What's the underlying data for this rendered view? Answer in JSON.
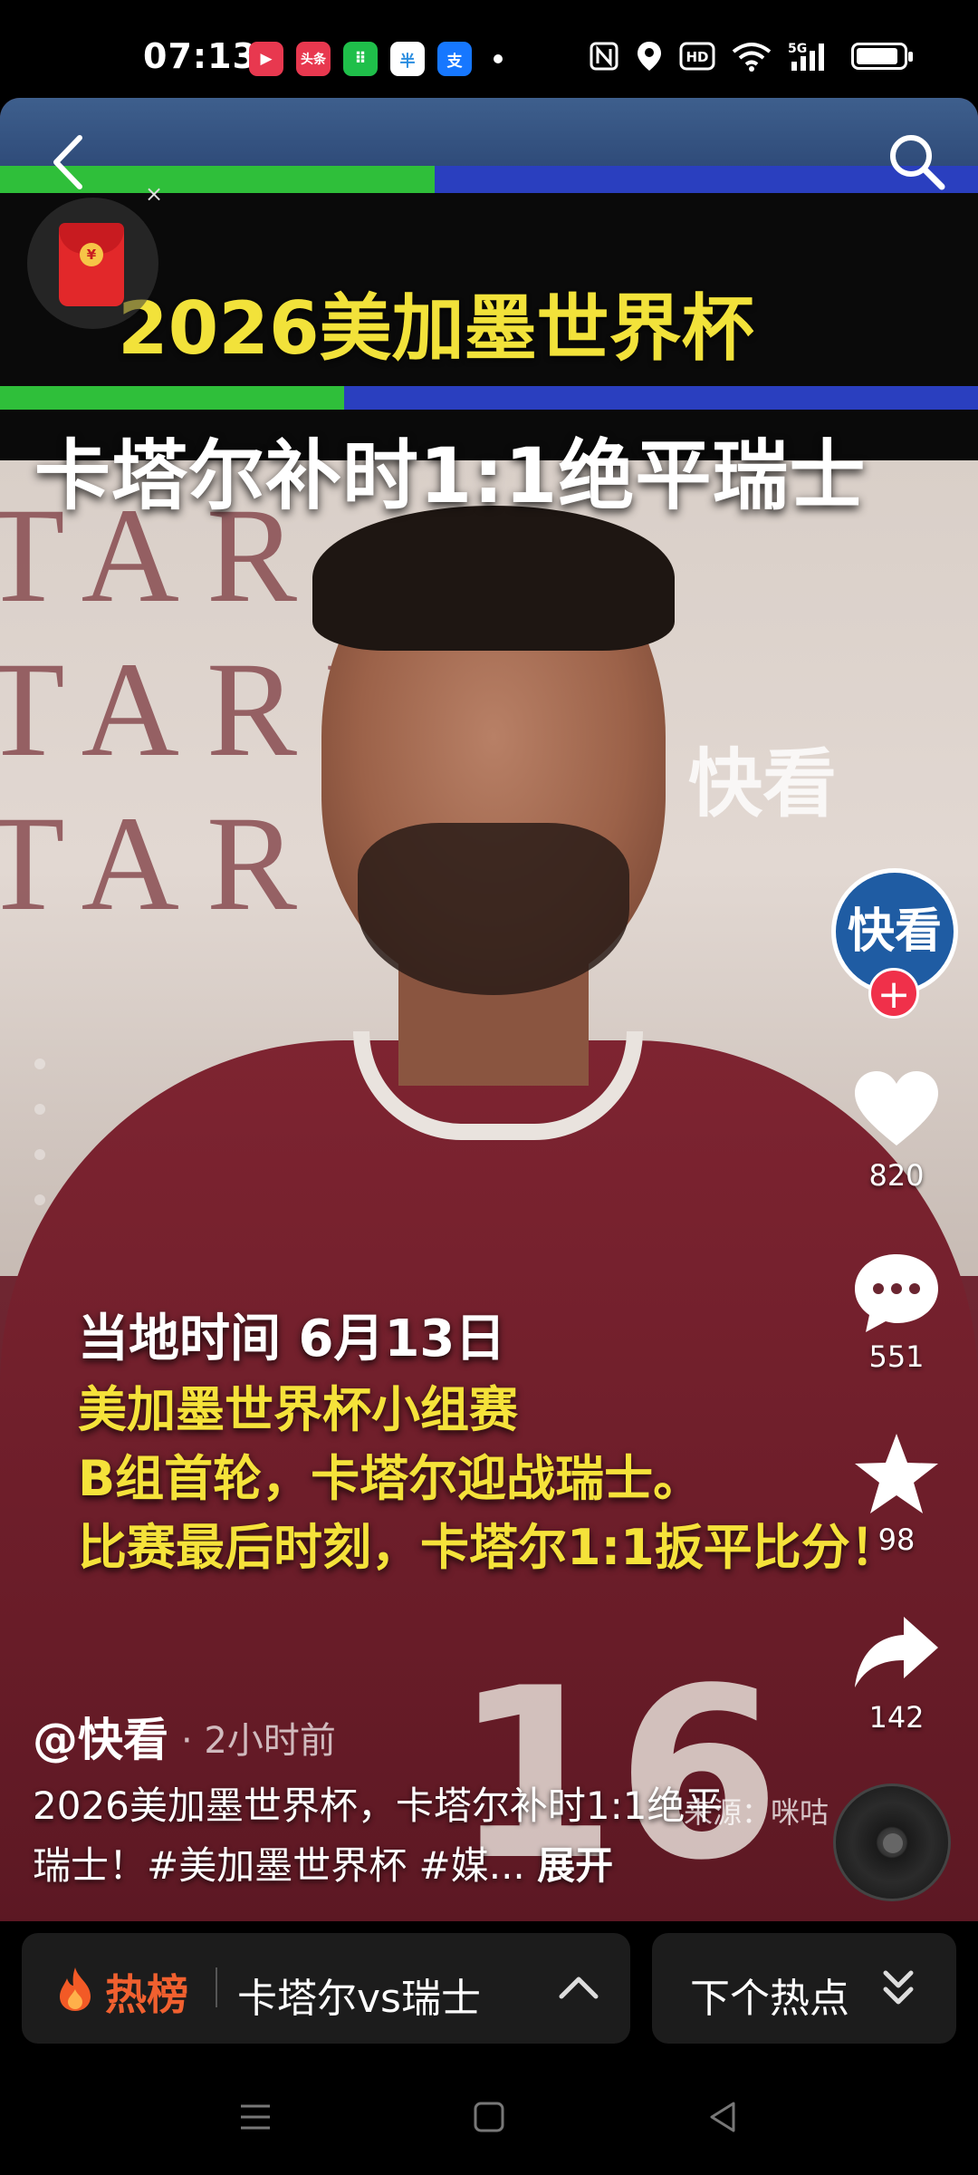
{
  "status_bar": {
    "time": "07:13",
    "apps": [
      {
        "name": "video-app-icon",
        "glyph": "▶",
        "color": "#e8384f"
      },
      {
        "name": "toutiao-app-icon",
        "glyph": "头条",
        "color": "#e8384f"
      },
      {
        "name": "wechat-mini-icon",
        "glyph": "⠿",
        "color": "#1fbf4a"
      },
      {
        "name": "shopping-app-icon",
        "glyph": "半",
        "color": "#2a8de0"
      },
      {
        "name": "alipay-app-icon",
        "glyph": "支",
        "color": "#1677ff"
      }
    ],
    "indicators": [
      "nfc-icon",
      "location-icon",
      "hd-icon",
      "wifi-icon",
      "5g-signal-icon",
      "battery-icon"
    ],
    "network": "5G",
    "hd": "HD",
    "nfc": "N",
    "battery_level": 0.8
  },
  "video": {
    "headline_line1": "2026美加墨世界杯",
    "headline_line2": "卡塔尔补时1:1绝平瑞士",
    "watermark": "快看",
    "caption_lines": [
      "当地时间 6月13日",
      "美加墨世界杯小组赛",
      "B组首轮，卡塔尔迎战瑞士。",
      "比赛最后时刻，卡塔尔1:1扳平比分！"
    ],
    "jersey_number": "16",
    "backdrop_text": [
      "TAR Q",
      "TARDA",
      "TAR Q"
    ],
    "red_packet_coin": "¥",
    "red_packet_close": "×"
  },
  "side_rail": {
    "avatar_text": "快看",
    "follow": "+",
    "likes": "820",
    "comments": "551",
    "favorites": "98",
    "shares": "142"
  },
  "post": {
    "author": "@快看",
    "time_ago": "· 2小时前",
    "description": "2026美加墨世界杯，卡塔尔补时1:1绝平瑞士！#美加墨世界杯 #媒...",
    "expand": "展开",
    "source": "来源：咪咕"
  },
  "bottom_bar": {
    "hot_label": "热榜",
    "hot_topic": "卡塔尔vs瑞士",
    "next_label": "下个热点"
  }
}
